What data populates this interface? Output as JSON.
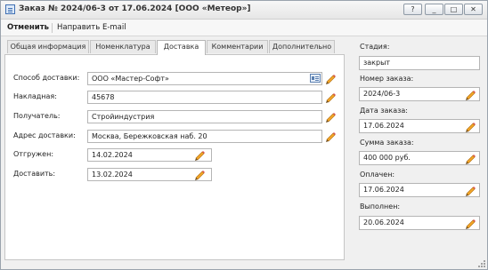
{
  "window": {
    "title": "Заказ № 2024/06-3 от 17.06.2024 [ООО «Метеор»]",
    "buttons": [
      "?",
      "_",
      "□",
      "✕"
    ]
  },
  "toolbar": {
    "cancel": "Отменить",
    "send_email": "Направить E-mail"
  },
  "tabs": [
    "Общая информация",
    "Номенклатура",
    "Доставка",
    "Комментарии",
    "Дополнительно"
  ],
  "active_tab": "Доставка",
  "delivery": {
    "method_label": "Способ доставки:",
    "method_value": "ООО «Мастер-Софт»",
    "invoice_label": "Накладная:",
    "invoice_value": "45678",
    "recipient_label": "Получатель:",
    "recipient_value": "Стройиндустрия",
    "address_label": "Адрес доставки:",
    "address_value": "Москва, Бережковская наб. 20",
    "shipped_label": "Отгружен:",
    "shipped_value": "14.02.2024",
    "deliver_label": "Доставить:",
    "deliver_value": "13.02.2024"
  },
  "side": {
    "stage_label": "Стадия:",
    "stage_value": "закрыт",
    "order_no_label": "Номер заказа:",
    "order_no_value": "2024/06-3",
    "order_date_label": "Дата заказа:",
    "order_date_value": "17.06.2024",
    "sum_label": "Сумма заказа:",
    "sum_value": "400 000 руб.",
    "paid_label": "Оплачен:",
    "paid_value": "17.06.2024",
    "done_label": "Выполнен:",
    "done_value": "20.06.2024"
  },
  "colors": {
    "pencil_body": "#f2a526",
    "pencil_tip": "#6b4a1d",
    "accent_blue": "#3f6fb3"
  }
}
